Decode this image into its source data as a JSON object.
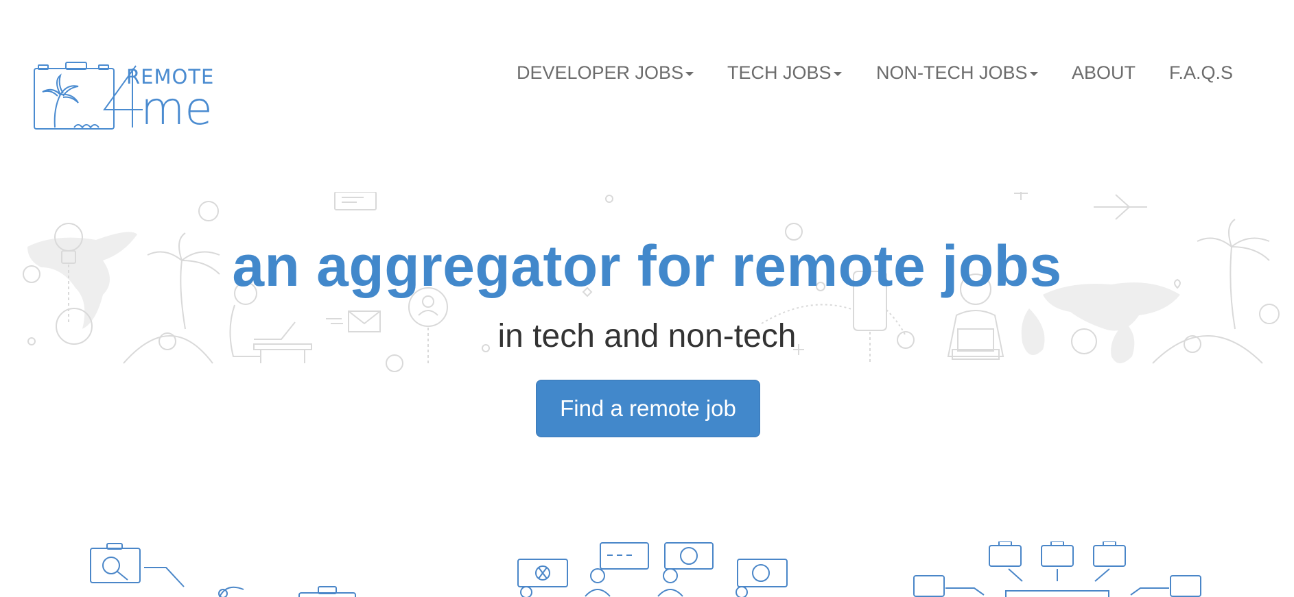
{
  "logo": {
    "remote": "REMOTE",
    "me": "me"
  },
  "nav": {
    "developer_jobs": "DEVELOPER JOBS",
    "tech_jobs": "TECH JOBS",
    "non_tech_jobs": "NON-TECH JOBS",
    "about": "ABOUT",
    "faqs": "F.A.Q.S"
  },
  "hero": {
    "title": "an aggregator for remote jobs",
    "subtitle": "in tech and non-tech",
    "cta_label": "Find a remote job"
  },
  "colors": {
    "accent": "#4288cb",
    "logo_blue": "#4a8bd0",
    "nav_text": "#6c6c6c",
    "illustration_gray": "#d9d9d9",
    "illustration_blue": "#4a86c8"
  },
  "icons": [
    "briefcase-palm-logo-icon",
    "lightbulb-icon",
    "world-map-icon",
    "palm-tree-icon",
    "woman-laptop-icon",
    "envelope-icon",
    "user-badge-icon",
    "phone-icon",
    "man-laptop-icon",
    "airplane-icon",
    "search-briefcase-icon",
    "team-chat-icon",
    "briefcase-network-icon"
  ]
}
